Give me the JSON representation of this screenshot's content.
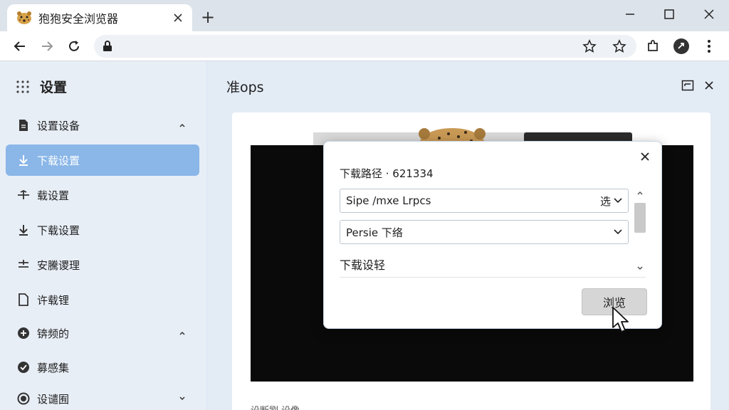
{
  "browser": {
    "tab_title": "狍狍安全浏览器",
    "new_tab_label": "+"
  },
  "sidebar": {
    "title": "设置",
    "items": [
      {
        "label": "设置设备",
        "icon": "document-icon",
        "chevron": "up"
      },
      {
        "label": "下载设置",
        "icon": "download-icon",
        "active": true
      },
      {
        "label": "载设置",
        "icon": "transfer-icon"
      },
      {
        "label": "下载设置",
        "icon": "download-icon"
      },
      {
        "label": "安騰谡理",
        "icon": "sliders-icon"
      },
      {
        "label": "许载锂",
        "icon": "document-icon"
      },
      {
        "label": "锛频的",
        "icon": "plus-circle-icon",
        "chevron": "up"
      },
      {
        "label": "募感集",
        "icon": "check-circle-icon"
      },
      {
        "label": "设谴囿",
        "icon": "radio-icon",
        "chevron": "down"
      }
    ]
  },
  "main": {
    "title": "准ops",
    "card_footer": "设断劉 设像"
  },
  "dialog": {
    "path_label": "下载路径 · 621334",
    "field1_value": "Sipe /mxe Lrpcs",
    "field1_suffix": "选",
    "field2_value": "Persie 下络",
    "section_label": "下载设轻",
    "browse_label": "浏览"
  },
  "colors": {
    "active_item": "#8ab6e8",
    "sidebar_bg": "#e8eef6",
    "main_bg": "#e3ebf5",
    "tabstrip_bg": "#dde3ea"
  }
}
